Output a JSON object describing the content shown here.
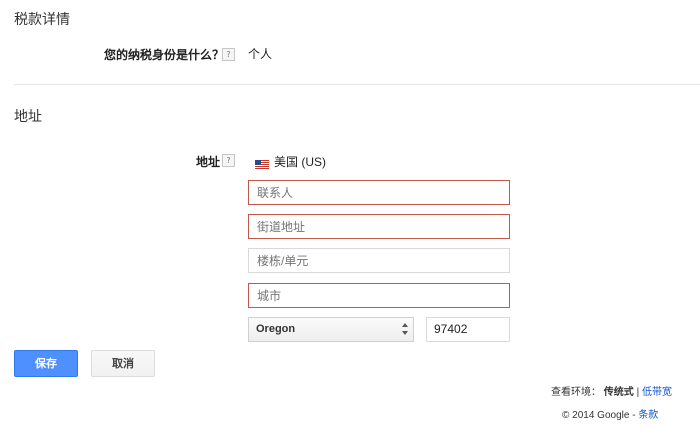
{
  "tax_section": {
    "title": "税款详情",
    "question_label": "您的纳税身份是什么？",
    "help_icon_text": "?",
    "answer": "个人"
  },
  "address_section": {
    "title": "地址",
    "field_label": "地址",
    "help_icon_text": "?",
    "country": "美国 (US)",
    "contact_placeholder": "联系人",
    "street_placeholder": "街道地址",
    "building_placeholder": "楼栋/单元",
    "city_placeholder": "城市",
    "state_value": "Oregon",
    "zip_value": "97402"
  },
  "buttons": {
    "save_label": "保存",
    "cancel_label": "取消"
  },
  "footer": {
    "view_env_label": "查看环境：",
    "classic_label": "传统式",
    "separator": "|",
    "low_bandwidth_label": "低带宽",
    "copyright": "© 2014 Google -",
    "terms_label": "条款"
  },
  "colors": {
    "error_border": "#c1584a",
    "primary_button": "#4d90fe",
    "link": "#1155cc"
  }
}
